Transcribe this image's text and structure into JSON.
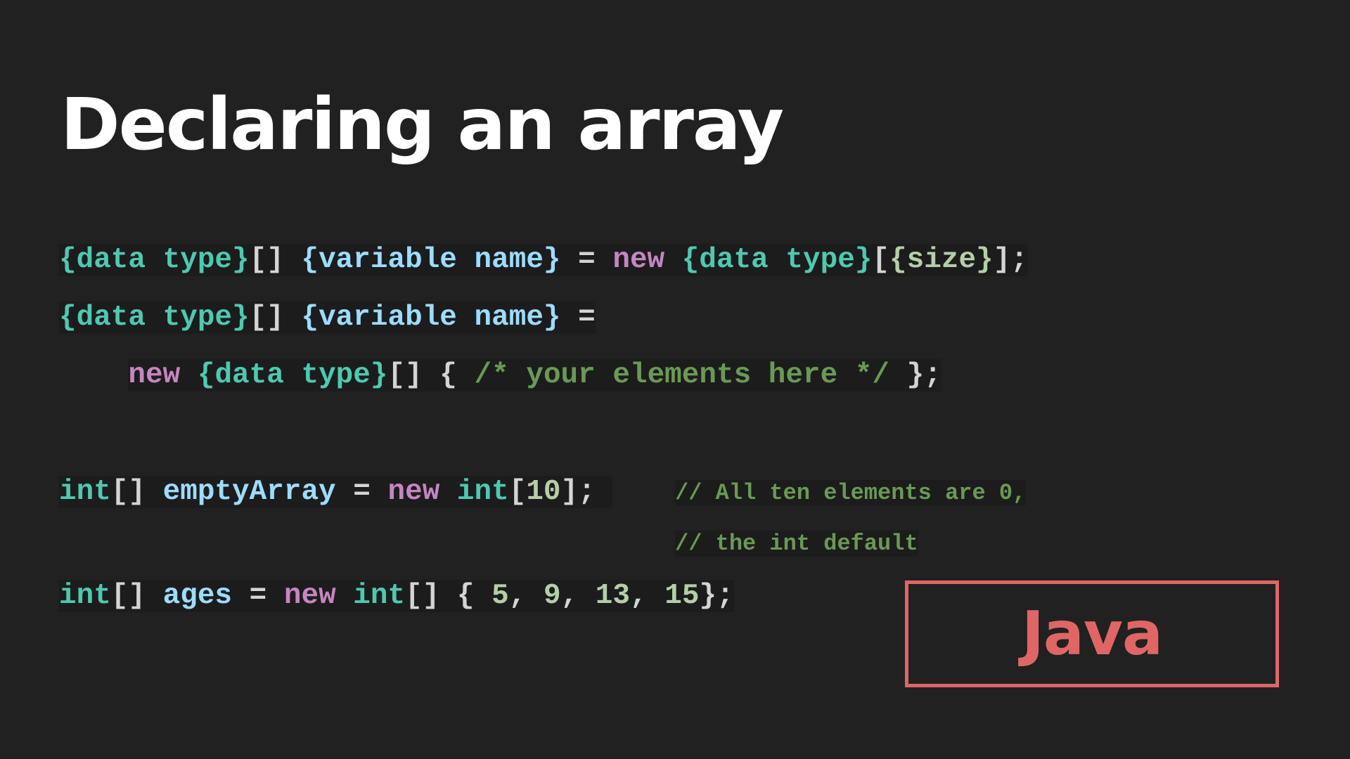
{
  "slide": {
    "title": "Declaring an array"
  },
  "code": {
    "lines": [
      [
        {
          "t": "{data type}",
          "k": "type"
        },
        {
          "t": "[] ",
          "k": "punc"
        },
        {
          "t": "{variable name}",
          "k": "var"
        },
        {
          "t": " = ",
          "k": "punc"
        },
        {
          "t": "new",
          "k": "kw"
        },
        {
          "t": " ",
          "k": "punc"
        },
        {
          "t": "{data type}",
          "k": "type"
        },
        {
          "t": "[",
          "k": "punc"
        },
        {
          "t": "{size}",
          "k": "param"
        },
        {
          "t": "];",
          "k": "punc"
        }
      ],
      [
        {
          "t": "{data type}",
          "k": "type"
        },
        {
          "t": "[] ",
          "k": "punc"
        },
        {
          "t": "{variable name}",
          "k": "var"
        },
        {
          "t": " =",
          "k": "punc"
        }
      ],
      [
        {
          "t": "    ",
          "k": "space"
        },
        {
          "t": "new",
          "k": "kw"
        },
        {
          "t": " ",
          "k": "punc"
        },
        {
          "t": "{data type}",
          "k": "type"
        },
        {
          "t": "[] { ",
          "k": "punc"
        },
        {
          "t": "/* your elements here */",
          "k": "comment"
        },
        {
          "t": " };",
          "k": "punc"
        }
      ],
      [],
      [
        {
          "t": "int",
          "k": "type"
        },
        {
          "t": "[] ",
          "k": "punc"
        },
        {
          "t": "emptyArray",
          "k": "var"
        },
        {
          "t": " = ",
          "k": "punc"
        },
        {
          "t": "new",
          "k": "kw"
        },
        {
          "t": " ",
          "k": "punc"
        },
        {
          "t": "int",
          "k": "type"
        },
        {
          "t": "[",
          "k": "punc"
        },
        {
          "t": "10",
          "k": "num"
        },
        {
          "t": "]; ",
          "k": "punc"
        }
      ],
      [],
      [
        {
          "t": "int",
          "k": "type"
        },
        {
          "t": "[] ",
          "k": "punc"
        },
        {
          "t": "ages",
          "k": "var"
        },
        {
          "t": " = ",
          "k": "punc"
        },
        {
          "t": "new",
          "k": "kw"
        },
        {
          "t": " ",
          "k": "punc"
        },
        {
          "t": "int",
          "k": "type"
        },
        {
          "t": "[] { ",
          "k": "punc"
        },
        {
          "t": "5",
          "k": "num"
        },
        {
          "t": ", ",
          "k": "punc"
        },
        {
          "t": "9",
          "k": "num"
        },
        {
          "t": ", ",
          "k": "punc"
        },
        {
          "t": "13",
          "k": "num"
        },
        {
          "t": ", ",
          "k": "punc"
        },
        {
          "t": "15",
          "k": "num"
        },
        {
          "t": "};",
          "k": "punc"
        }
      ]
    ],
    "comments": [
      {
        "line": 4,
        "text": "// All ten elements are 0,"
      },
      {
        "line": 5,
        "text": "// the int default"
      }
    ]
  },
  "badge": {
    "label": "Java"
  },
  "colors": {
    "background": "#212121",
    "title": "#ffffff",
    "type": "#4ec9b0",
    "variable": "#9cdcfe",
    "keyword": "#c586c0",
    "number": "#b5cea8",
    "comment": "#6a9955",
    "badge": "#e06666"
  }
}
